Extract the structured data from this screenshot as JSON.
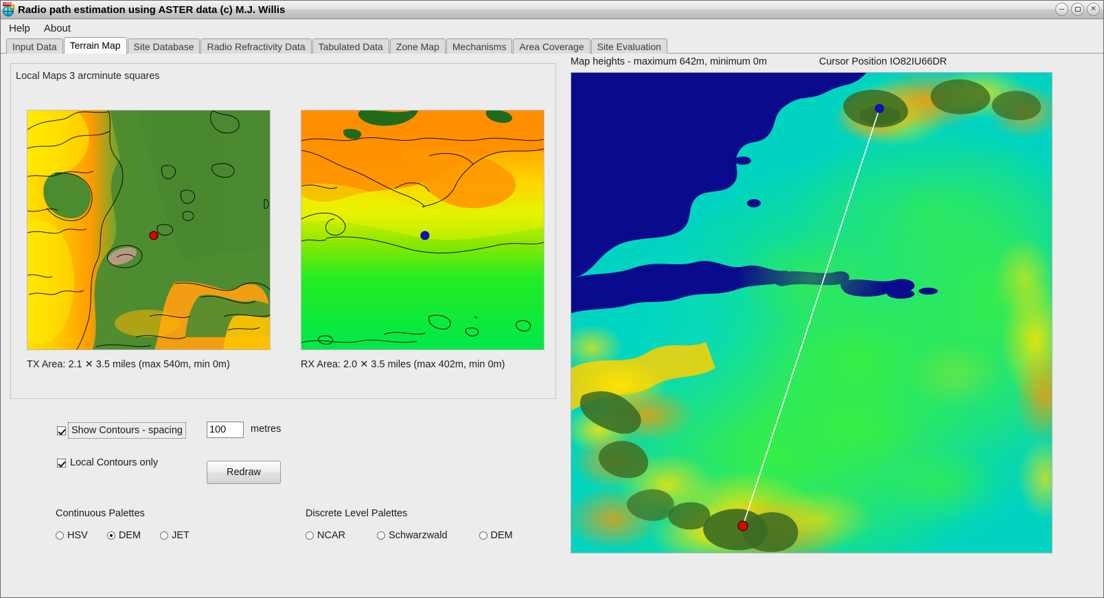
{
  "window": {
    "title": "Radio path estimation using ASTER data (c) M.J. Willis",
    "icon": "globe-icon",
    "minimize_label": "–",
    "maximize_label": "",
    "close_label": "✕"
  },
  "menubar": {
    "items": [
      {
        "label": "Help"
      },
      {
        "label": "About"
      }
    ]
  },
  "tabs": {
    "active": "Terrain Map",
    "items": [
      {
        "label": "Input Data"
      },
      {
        "label": "Terrain Map"
      },
      {
        "label": "Site Database"
      },
      {
        "label": "Radio Refractivity Data"
      },
      {
        "label": "Tabulated Data"
      },
      {
        "label": "Zone Map"
      },
      {
        "label": "Mechanisms"
      },
      {
        "label": "Area Coverage"
      },
      {
        "label": "Site Evaluation"
      }
    ]
  },
  "local_maps": {
    "group_title": "Local Maps 3 arcminute squares",
    "tx": {
      "caption": "TX Area: 2.1 ✕ 3.5 miles  (max 540m,  min 0m)",
      "marker_color": "#e00000",
      "marker_type": "tx-marker"
    },
    "rx": {
      "caption": "RX Area: 2.0 ✕ 3.5 miles  (max 402m,  min 0m)",
      "marker_color": "#1010c8",
      "marker_type": "rx-marker"
    }
  },
  "controls": {
    "show_contours": {
      "label": "Show Contours - spacing",
      "checked": true,
      "focused": true
    },
    "local_contours": {
      "label": "Local Contours only",
      "checked": true
    },
    "spacing": {
      "value": "100",
      "placeholder": "100",
      "unit_label": "metres"
    },
    "redraw_label": "Redraw",
    "continuous_palettes": {
      "heading": "Continuous Palettes",
      "selected": "DEM",
      "options": [
        {
          "label": "HSV",
          "selected": false
        },
        {
          "label": "DEM",
          "selected": true
        },
        {
          "label": "JET",
          "selected": false
        }
      ]
    },
    "discrete_palettes": {
      "heading": "Discrete Level Palettes",
      "selected": "",
      "options": [
        {
          "label": "NCAR",
          "selected": false
        },
        {
          "label": "Schwarzwald",
          "selected": false
        },
        {
          "label": "DEM",
          "selected": false
        }
      ]
    }
  },
  "main_map": {
    "heights_label": "Map heights - maximum 642m,  minimum 0m",
    "cursor_label": "Cursor Position IO82IU66DR",
    "max_height_m": 642,
    "min_height_m": 0,
    "path_line_color": "#ffffff",
    "tx_marker_color": "#e00000",
    "rx_marker_color": "#1010c8"
  },
  "colors": {
    "sea": "#0a0a8c",
    "low_land": "#00cfc0",
    "mid_land": "#22dd33",
    "high_land": "#ffd000",
    "peak": "#f08000",
    "forest": "#2f6b1f"
  }
}
